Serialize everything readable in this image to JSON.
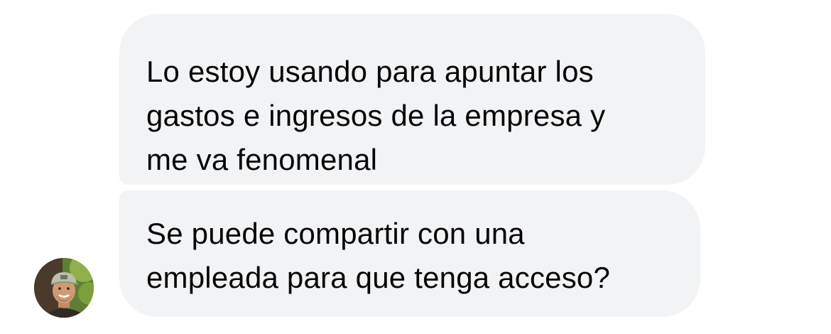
{
  "conversation": {
    "messages": [
      {
        "lines": [
          "Lo estoy usando para apuntar los",
          "gastos e ingresos de la empresa y",
          "me va fenomenal"
        ]
      },
      {
        "lines": [
          "Se puede compartir con una",
          "empleada para que tenga acceso?"
        ]
      }
    ]
  },
  "colors": {
    "bubble_background": "#f2f3f5",
    "text": "#050505"
  },
  "icons": {
    "avatar": "sender-avatar-photo"
  }
}
